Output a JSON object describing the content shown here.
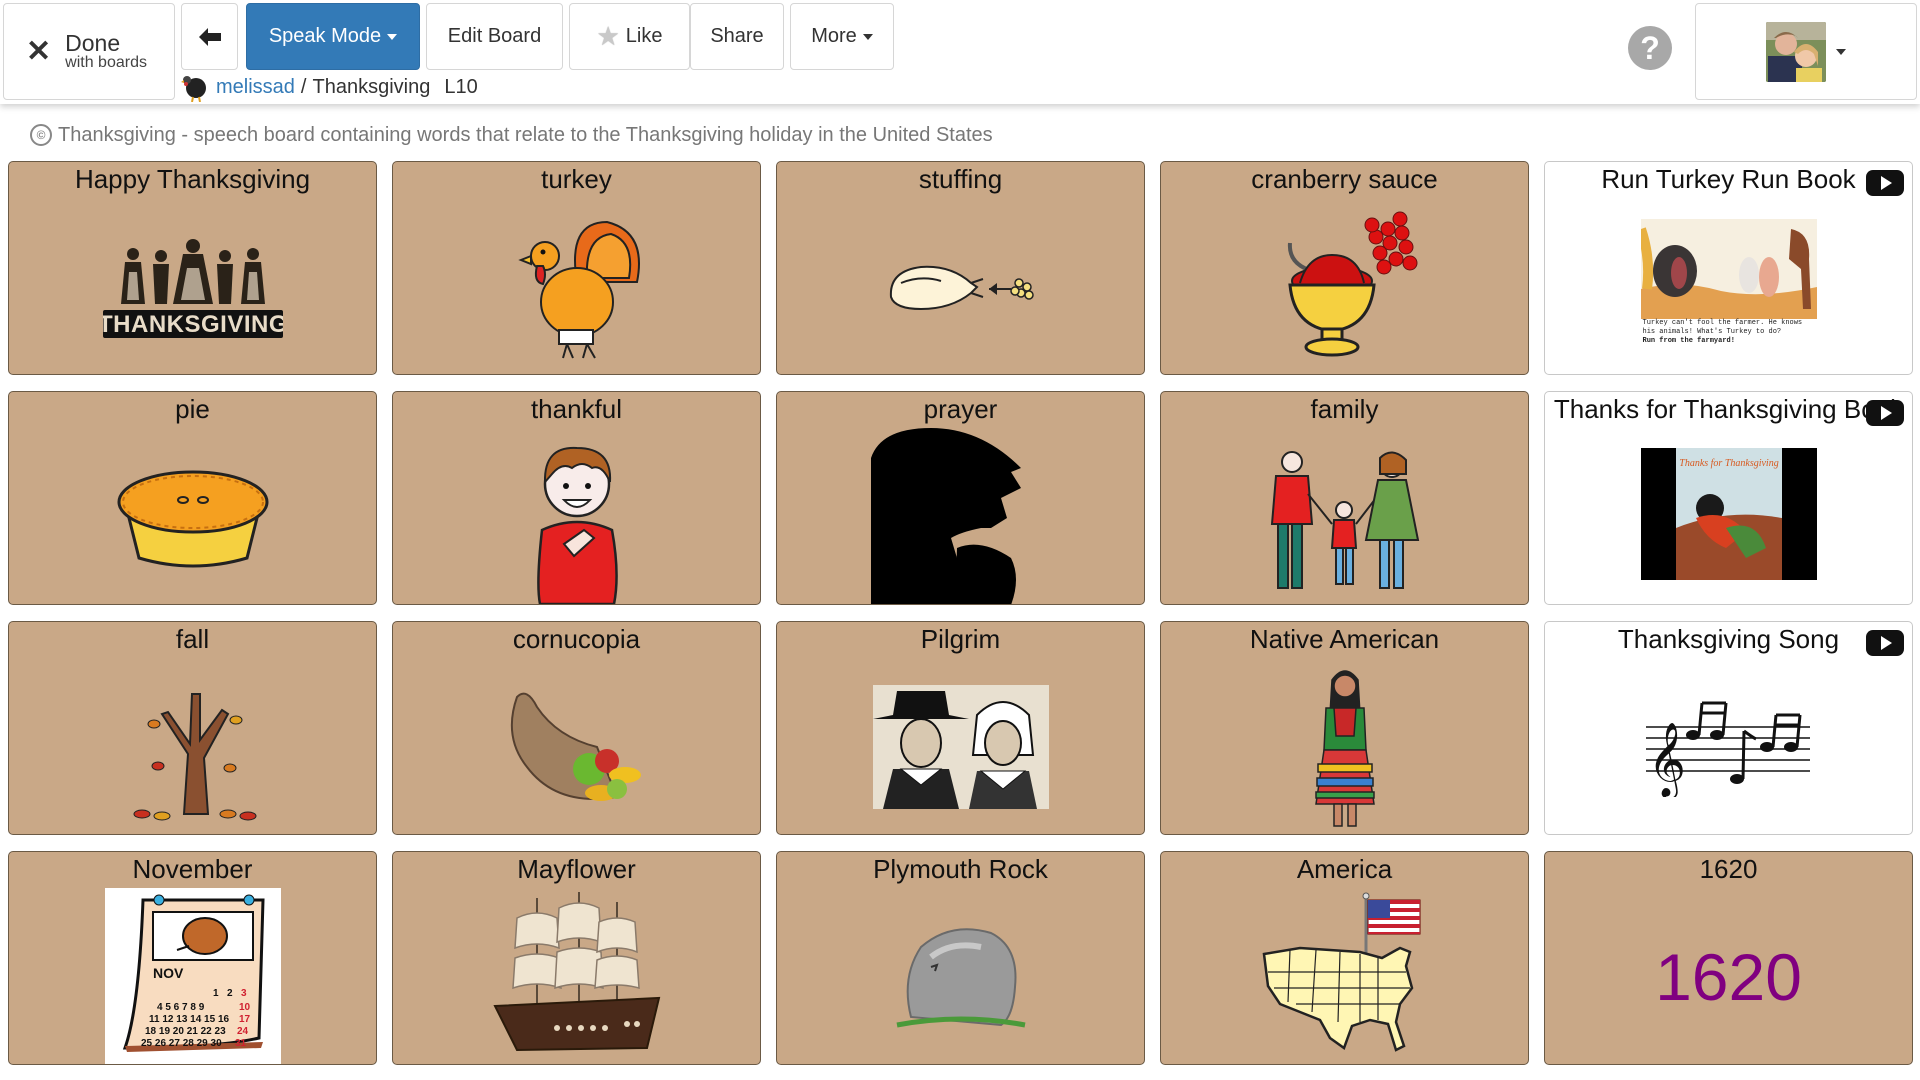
{
  "header": {
    "done": {
      "main": "Done",
      "sub": "with boards",
      "icon": "close-icon"
    },
    "back_icon": "arrow-left-icon",
    "speak_mode_label": "Speak Mode",
    "edit_board_label": "Edit Board",
    "like_label": "Like",
    "share_label": "Share",
    "more_label": "More",
    "help_glyph": "?",
    "accent_color": "#337ab7"
  },
  "breadcrumb": {
    "user": "melissad",
    "separator": "/",
    "board": "Thanksgiving",
    "level": "L10"
  },
  "description": {
    "license_glyph": "©",
    "text": "Thanksgiving - speech board containing words that relate to the Thanksgiving holiday in the United States"
  },
  "tile_color": "#c9a887",
  "tiles": [
    {
      "label": "Happy Thanksgiving",
      "image": "pilgrims-thanksgiving"
    },
    {
      "label": "turkey",
      "image": "turkey"
    },
    {
      "label": "stuffing",
      "image": "stuffing"
    },
    {
      "label": "cranberry sauce",
      "image": "cranberry-sauce"
    },
    {
      "label": "Run Turkey Run Book",
      "image": "book-run-turkey-run",
      "video": true,
      "caption_lines": [
        "Turkey can't fool the farmer. He knows",
        "his animals! What's Turkey to do?",
        "Run from the farmyard!"
      ]
    },
    {
      "label": "pie",
      "image": "pie"
    },
    {
      "label": "thankful",
      "image": "thankful-boy"
    },
    {
      "label": "prayer",
      "image": "prayer-silhouette"
    },
    {
      "label": "family",
      "image": "family"
    },
    {
      "label": "Thanks for Thanksgiving Book",
      "image": "book-thanks-for-thanksgiving",
      "video": true,
      "cover_title": "Thanks for Thanksgiving"
    },
    {
      "label": "fall",
      "image": "fall-tree"
    },
    {
      "label": "cornucopia",
      "image": "cornucopia"
    },
    {
      "label": "Pilgrim",
      "image": "pilgrims"
    },
    {
      "label": "Native American",
      "image": "native-american"
    },
    {
      "label": "Thanksgiving Song",
      "image": "music-notes",
      "video": true
    },
    {
      "label": "November",
      "image": "calendar-november",
      "month": "NOV"
    },
    {
      "label": "Mayflower",
      "image": "ship"
    },
    {
      "label": "Plymouth Rock",
      "image": "rock"
    },
    {
      "label": "America",
      "image": "usa-map-flag"
    },
    {
      "label": "1620",
      "image": "text-1620",
      "big_text": "1620",
      "big_text_color": "#800080"
    }
  ]
}
